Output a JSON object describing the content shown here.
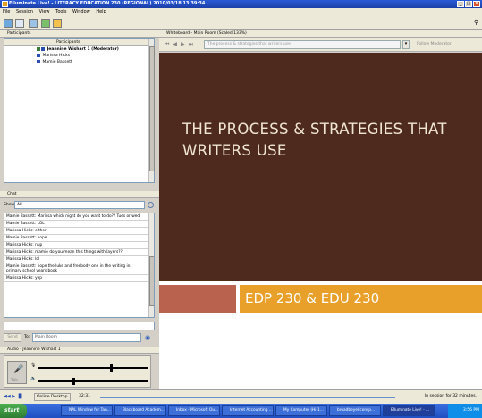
{
  "window": {
    "title": "Elluminate Live! - LITERACY EDUCATION 230 (REGIONAL) 2010/03/18 13:39:34",
    "minimize": "_",
    "maximize": "□",
    "close": "×"
  },
  "menu": [
    "File",
    "Session",
    "View",
    "Tools",
    "Window",
    "Help"
  ],
  "participants": {
    "panel_title": "Participants",
    "column_label": "Participants",
    "list": [
      {
        "name": "Jeannine Wishart 1 (Moderator)",
        "bold": true
      },
      {
        "name": "Marissa Hicks",
        "bold": false
      },
      {
        "name": "Mamie Bassett",
        "bold": false
      }
    ]
  },
  "chat": {
    "panel_title": "Chat",
    "show_label": "Show",
    "show_value": "All",
    "messages": [
      "Mamie Bassett: Marissa which night do you want to do?? Tues or wed",
      "Mamie Bassett: LOL",
      "Marissa Hicks: either",
      "Mamie Bassett: nope",
      "Marissa Hicks: nup",
      "Marissa Hicks: mamie do you mean this things with layers??",
      "Marissa Hicks: lol",
      "Mamie Bassett: nope the luke and freebody one in the writing in primary school years book",
      "Marissa Hicks: yep"
    ],
    "send_label": "Send",
    "to_label": "To:",
    "to_value": "Main Room"
  },
  "audio": {
    "panel_title": "Audio - Jeannine Wishart 1",
    "talk_label": "Talk"
  },
  "whiteboard": {
    "panel_title": "Whiteboard - Main Room (Scaled 133%)",
    "page_value": "The process & strategies that writers use",
    "follow_label": "Follow Moderator",
    "slide_title": "THE PROCESS & STRATEGIES THAT WRITERS USE",
    "slide_subtitle": "EDP 230 & EDU 230"
  },
  "status": {
    "online_label": "Online Desktop",
    "time": "32:31",
    "session_text": "In session for 32 minutes."
  },
  "taskbar": {
    "start": "start",
    "tasks": [
      "NAL Window for Tan...",
      "Blackboard Academ...",
      "Inbox - Microsoft Ou...",
      "Internet Accounting ...",
      "My Computer (Hi-1...",
      "broadbeyeliconsp...",
      "Elluminate Live! - ..."
    ],
    "clock": "3:56 PM"
  },
  "colors": {
    "slide_background": "#4e2a1e",
    "slide_title": "#f0e6d0",
    "accent_orange": "#e8a02a",
    "accent_rust": "#b9634e",
    "taskbar_blue": "#1f4fc0"
  }
}
